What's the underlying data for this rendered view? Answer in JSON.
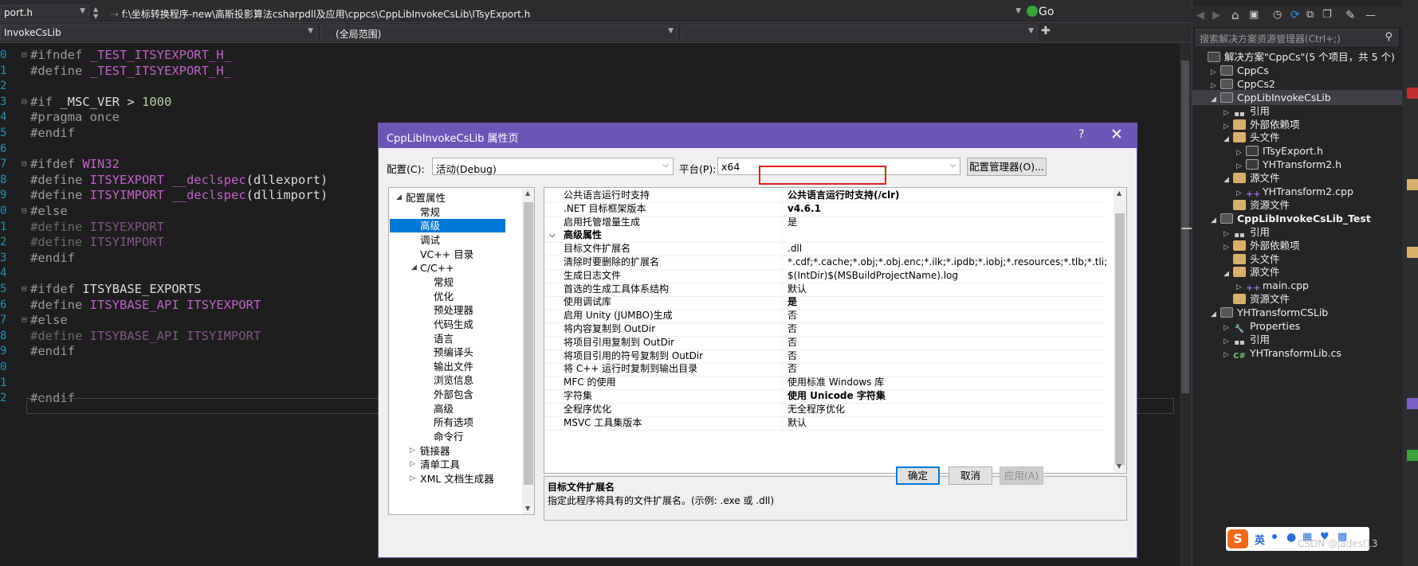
{
  "path_bar": {
    "file_combo": "port.h",
    "path": "f:\\坐标转换程序-new\\高斯投影算法csharpdll及应用\\cppcs\\CppLibInvokeCsLib\\ITsyExport.h",
    "go_label": "Go"
  },
  "nav_bar": {
    "project_combo": "InvokeCsLib",
    "scope_combo": "(全局范围)"
  },
  "editor": {
    "line_numbers": [
      "0",
      "1",
      "2",
      "3",
      "4",
      "5",
      "6",
      "7",
      "8",
      "9",
      "0",
      "1",
      "2",
      "3",
      "4",
      "5",
      "6",
      "7",
      "8",
      "9",
      "0",
      "1",
      "2"
    ],
    "lines": [
      {
        "tokens": [
          {
            "t": "#ifndef ",
            "c": "kw"
          },
          {
            "t": "_TEST_ITSYEXPORT_H_",
            "c": "mac"
          }
        ]
      },
      {
        "tokens": [
          {
            "t": "#define ",
            "c": "kw"
          },
          {
            "t": "_TEST_ITSYEXPORT_H_",
            "c": "mac"
          }
        ]
      },
      {
        "tokens": []
      },
      {
        "tokens": [
          {
            "t": "#if ",
            "c": "kw"
          },
          {
            "t": "_MSC_VER",
            "c": "id"
          },
          {
            "t": " > ",
            "c": "id"
          },
          {
            "t": "1000",
            "c": "num"
          }
        ]
      },
      {
        "tokens": [
          {
            "t": "#pragma once",
            "c": "kw"
          }
        ]
      },
      {
        "tokens": [
          {
            "t": "#endif",
            "c": "kw"
          }
        ]
      },
      {
        "tokens": []
      },
      {
        "tokens": [
          {
            "t": "#ifdef ",
            "c": "kw"
          },
          {
            "t": "WIN32",
            "c": "mac"
          }
        ]
      },
      {
        "tokens": [
          {
            "t": "#define ",
            "c": "kw"
          },
          {
            "t": "ITSYEXPORT",
            "c": "mac"
          },
          {
            "t": " ",
            "c": "id"
          },
          {
            "t": "__declspec",
            "c": "mac"
          },
          {
            "t": "(dllexport)",
            "c": "id"
          }
        ]
      },
      {
        "tokens": [
          {
            "t": "#define ",
            "c": "kw"
          },
          {
            "t": "ITSYIMPORT",
            "c": "mac"
          },
          {
            "t": " ",
            "c": "id"
          },
          {
            "t": "__declspec",
            "c": "mac"
          },
          {
            "t": "(dllimport)",
            "c": "id"
          }
        ]
      },
      {
        "tokens": [
          {
            "t": "#else",
            "c": "kw"
          }
        ]
      },
      {
        "tokens": [
          {
            "t": "#define ",
            "c": "dim"
          },
          {
            "t": "ITSYEXPORT",
            "c": "macdim"
          }
        ]
      },
      {
        "tokens": [
          {
            "t": "#define ",
            "c": "dim"
          },
          {
            "t": "ITSYIMPORT",
            "c": "macdim"
          }
        ]
      },
      {
        "tokens": [
          {
            "t": "#endif",
            "c": "kw"
          }
        ]
      },
      {
        "tokens": []
      },
      {
        "tokens": [
          {
            "t": "#ifdef ",
            "c": "kw"
          },
          {
            "t": "ITSYBASE_EXPORTS",
            "c": "id"
          }
        ]
      },
      {
        "tokens": [
          {
            "t": "#define ",
            "c": "kw"
          },
          {
            "t": "ITSYBASE_API",
            "c": "mac"
          },
          {
            "t": " ",
            "c": "id"
          },
          {
            "t": "ITSYEXPORT",
            "c": "mac"
          }
        ]
      },
      {
        "tokens": [
          {
            "t": "#else",
            "c": "kw"
          }
        ]
      },
      {
        "tokens": [
          {
            "t": "#define ",
            "c": "dim"
          },
          {
            "t": "ITSYBASE_API",
            "c": "macdim"
          },
          {
            "t": " ",
            "c": "dim"
          },
          {
            "t": "ITSYIMPORT",
            "c": "macdim"
          }
        ]
      },
      {
        "tokens": [
          {
            "t": "#endif",
            "c": "kw"
          }
        ]
      },
      {
        "tokens": []
      },
      {
        "tokens": []
      },
      {
        "tokens": [
          {
            "t": "#endif",
            "c": "kw"
          }
        ]
      }
    ]
  },
  "solution_explorer": {
    "search_placeholder": "搜索解决方案资源管理器(Ctrl+;)",
    "items": [
      {
        "label": "解决方案\"CppCs\"(5 个项目，共 5 个)",
        "icon": "solution-icon",
        "expander": ""
      },
      {
        "label": "CppCs",
        "icon": "project-icon",
        "expander": "▷"
      },
      {
        "label": "CppCs2",
        "icon": "project-icon",
        "expander": "▷"
      },
      {
        "label": "CppLibInvokeCsLib",
        "icon": "project-icon",
        "expander": "◢"
      },
      {
        "label": "引用",
        "icon": "references-icon",
        "expander": "▷"
      },
      {
        "label": "外部依赖项",
        "icon": "folder-icon",
        "expander": "▷"
      },
      {
        "label": "头文件",
        "icon": "folder-icon",
        "expander": "◢"
      },
      {
        "label": "ITsyExport.h",
        "icon": "header-file-icon",
        "expander": "▷"
      },
      {
        "label": "YHTransform2.h",
        "icon": "header-file-icon",
        "expander": "▷"
      },
      {
        "label": "源文件",
        "icon": "folder-icon",
        "expander": "◢"
      },
      {
        "label": "YHTransform2.cpp",
        "icon": "cpp-file-icon",
        "expander": "▷"
      },
      {
        "label": "资源文件",
        "icon": "folder-icon",
        "expander": ""
      },
      {
        "label": "CppLibInvokeCsLib_Test",
        "icon": "project-icon",
        "expander": "◢"
      },
      {
        "label": "引用",
        "icon": "references-icon",
        "expander": "▷"
      },
      {
        "label": "外部依赖项",
        "icon": "folder-icon",
        "expander": "▷"
      },
      {
        "label": "头文件",
        "icon": "folder-icon",
        "expander": ""
      },
      {
        "label": "源文件",
        "icon": "folder-icon",
        "expander": "◢"
      },
      {
        "label": "main.cpp",
        "icon": "cpp-file-icon",
        "expander": "▷"
      },
      {
        "label": "资源文件",
        "icon": "folder-icon",
        "expander": ""
      },
      {
        "label": "YHTransformCSLib",
        "icon": "project-icon",
        "expander": "◢"
      },
      {
        "label": "Properties",
        "icon": "wrench-icon",
        "expander": "▷"
      },
      {
        "label": "引用",
        "icon": "references-icon",
        "expander": "▷"
      },
      {
        "label": "YHTransformLib.cs",
        "icon": "cs-file-icon",
        "expander": "▷"
      }
    ]
  },
  "dialog": {
    "title": "CppLibInvokeCsLib 属性页",
    "help": "?",
    "close": "✕",
    "config_label": "配置(C):",
    "config_value": "活动(Debug)",
    "platform_label": "平台(P):",
    "platform_value": "x64",
    "config_manager": "配置管理器(O)...",
    "tree": [
      {
        "label": "配置属性",
        "expander": "◢"
      },
      {
        "label": "常规",
        "expander": ""
      },
      {
        "label": "高级",
        "expander": ""
      },
      {
        "label": "调试",
        "expander": ""
      },
      {
        "label": "VC++ 目录",
        "expander": ""
      },
      {
        "label": "C/C++",
        "expander": "◢"
      },
      {
        "label": "常规",
        "expander": ""
      },
      {
        "label": "优化",
        "expander": ""
      },
      {
        "label": "预处理器",
        "expander": ""
      },
      {
        "label": "代码生成",
        "expander": ""
      },
      {
        "label": "语言",
        "expander": ""
      },
      {
        "label": "预编译头",
        "expander": ""
      },
      {
        "label": "输出文件",
        "expander": ""
      },
      {
        "label": "浏览信息",
        "expander": ""
      },
      {
        "label": "外部包含",
        "expander": ""
      },
      {
        "label": "高级",
        "expander": ""
      },
      {
        "label": "所有选项",
        "expander": ""
      },
      {
        "label": "命令行",
        "expander": ""
      },
      {
        "label": "链接器",
        "expander": "▷"
      },
      {
        "label": "清单工具",
        "expander": "▷"
      },
      {
        "label": "XML 文档生成器",
        "expander": "▷"
      }
    ],
    "properties": [
      {
        "name": "公共语言运行时支持",
        "value": "公共语言运行时支持(/clr)",
        "bold": true
      },
      {
        "name": ".NET 目标框架版本",
        "value": "v4.6.1",
        "bold": true
      },
      {
        "name": "启用托管增量生成",
        "value": "是",
        "bold": false
      },
      {
        "name": "高级属性",
        "value": "",
        "bold": false,
        "category": true
      },
      {
        "name": "目标文件扩展名",
        "value": ".dll",
        "bold": false
      },
      {
        "name": "清除时要删除的扩展名",
        "value": "*.cdf;*.cache;*.obj;*.obj.enc;*.ilk;*.ipdb;*.iobj;*.resources;*.tlb;*.tli;*.tlh;*.t",
        "bold": false
      },
      {
        "name": "生成日志文件",
        "value": "$(IntDir)$(MSBuildProjectName).log",
        "bold": false
      },
      {
        "name": "首选的生成工具体系结构",
        "value": "默认",
        "bold": false
      },
      {
        "name": "使用调试库",
        "value": "是",
        "bold": true
      },
      {
        "name": "启用 Unity (JUMBO)生成",
        "value": "否",
        "bold": false
      },
      {
        "name": "将内容复制到 OutDir",
        "value": "否",
        "bold": false
      },
      {
        "name": "将项目引用复制到 OutDir",
        "value": "否",
        "bold": false
      },
      {
        "name": "将项目引用的符号复制到 OutDir",
        "value": "否",
        "bold": false
      },
      {
        "name": "将 C++ 运行时复制到输出目录",
        "value": "否",
        "bold": false
      },
      {
        "name": "MFC 的使用",
        "value": "使用标准 Windows 库",
        "bold": false
      },
      {
        "name": "字符集",
        "value": "使用 Unicode 字符集",
        "bold": true
      },
      {
        "name": "全程序优化",
        "value": "无全程序优化",
        "bold": false
      },
      {
        "name": "MSVC 工具集版本",
        "value": "默认",
        "bold": false
      }
    ],
    "description_title": "目标文件扩展名",
    "description_text": "指定此程序将具有的文件扩展名。(示例: .exe 或 .dll)",
    "ok": "确定",
    "cancel": "取消",
    "apply": "应用(A)"
  },
  "ime": {
    "logo": "S",
    "lang": "英"
  },
  "watermark": "CSDN @jadesl13"
}
